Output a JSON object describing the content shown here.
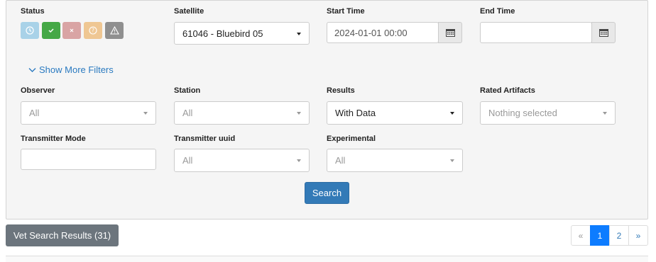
{
  "filters": {
    "status": {
      "label": "Status",
      "buttons": [
        {
          "name": "status-future",
          "icon": "clock-icon",
          "color": "#a9d2e8"
        },
        {
          "name": "status-good",
          "icon": "check-icon",
          "color": "#45a846"
        },
        {
          "name": "status-bad",
          "icon": "x-icon",
          "color": "#d9a4a4"
        },
        {
          "name": "status-unknown",
          "icon": "question-icon",
          "color": "#efc793"
        },
        {
          "name": "status-failed",
          "icon": "warning-icon",
          "color": "#8f8f8f"
        }
      ]
    },
    "satellite": {
      "label": "Satellite",
      "value": "61046 - Bluebird 05"
    },
    "start_time": {
      "label": "Start Time",
      "value": "2024-01-01 00:00"
    },
    "end_time": {
      "label": "End Time",
      "value": ""
    },
    "show_more": "Show More Filters",
    "observer": {
      "label": "Observer",
      "value": "All"
    },
    "station": {
      "label": "Station",
      "value": "All"
    },
    "results": {
      "label": "Results",
      "value": "With Data"
    },
    "rated_artifacts": {
      "label": "Rated Artifacts",
      "value": "Nothing selected"
    },
    "transmitter_mode": {
      "label": "Transmitter Mode",
      "value": ""
    },
    "transmitter_uuid": {
      "label": "Transmitter uuid",
      "value": "All"
    },
    "experimental": {
      "label": "Experimental",
      "value": "All"
    },
    "search_button": "Search"
  },
  "vet_button": "Vet Search Results (31)",
  "pagination": {
    "prev": "«",
    "pages": [
      "1",
      "2"
    ],
    "active_page": "1",
    "next": "»"
  }
}
